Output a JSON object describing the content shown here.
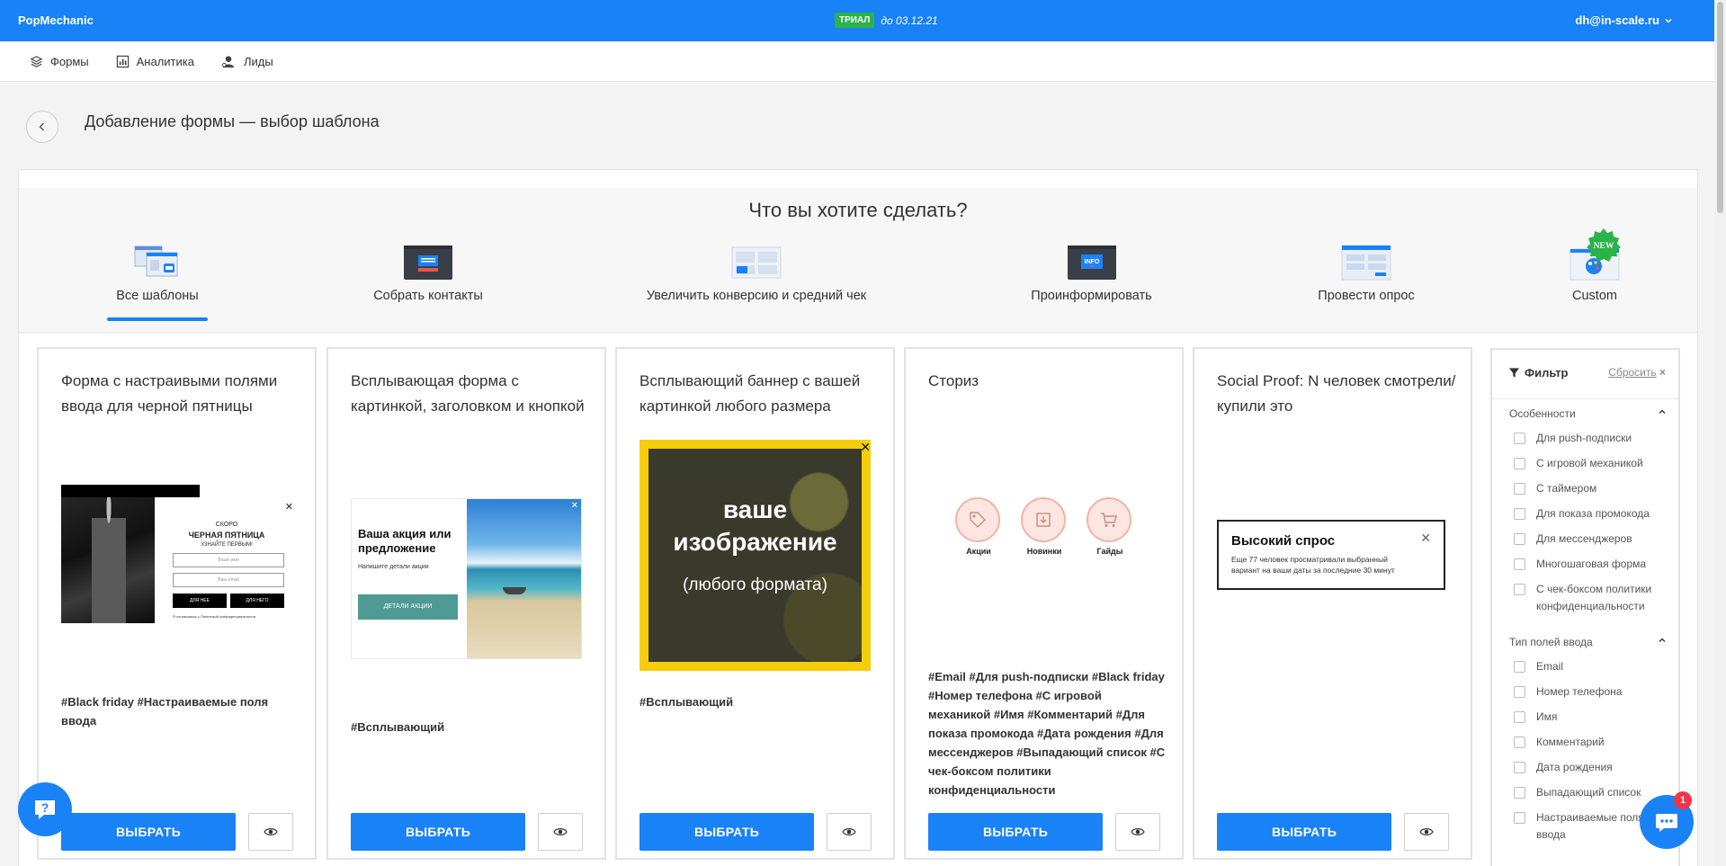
{
  "app": {
    "brand": "PopMechanic",
    "trial_badge": "ТРИАЛ",
    "trial_until": "до 03.12.21",
    "user_email": "dh@in-scale.ru"
  },
  "nav": {
    "items": [
      {
        "label": "Формы",
        "icon": "layers-icon"
      },
      {
        "label": "Аналитика",
        "icon": "analytics-icon"
      },
      {
        "label": "Лиды",
        "icon": "leads-icon"
      }
    ]
  },
  "page": {
    "title": "Добавление формы — выбор шаблона",
    "question": "Что вы хотите сделать?"
  },
  "categories": [
    {
      "label": "Все шаблоны",
      "active": true
    },
    {
      "label": "Собрать контакты"
    },
    {
      "label": "Увеличить конверсию и средний чек"
    },
    {
      "label": "Проинформировать",
      "icon_text": "INFO"
    },
    {
      "label": "Провести опрос"
    },
    {
      "label": "Custom",
      "badge": "NEW"
    }
  ],
  "cards": [
    {
      "title": "Форма с настраивыми полями ввода для черной пятницы",
      "tags": "#Black friday #Настраиваемые поля ввода",
      "preview": {
        "line1": "СКОРО",
        "line2": "ЧЕРНАЯ ПЯТНИЦА",
        "line3": "УЗНАЙТЕ ПЕРВЫМ!",
        "field1": "Ваше имя",
        "field2": "Ваш email",
        "btn1": "ДЛЯ НЕЕ",
        "btn2": "ДЛЯ НЕГО",
        "consent": "Я соглашаюсь с Политикой конфиденциальности"
      }
    },
    {
      "title": "Всплывающая форма с картинкой, заголовком и кнопкой",
      "tags": "#Всплывающий",
      "preview": {
        "heading": "Ваша акция или предложение",
        "sub": "Напишите детали акции",
        "button": "ДЕТАЛИ АКЦИИ"
      }
    },
    {
      "title": "Всплывающий баннер с вашей картинкой любого размера",
      "tags": "#Всплывающий",
      "preview": {
        "line1": "ваше",
        "line2": "изображение",
        "line3": "(любого формата)"
      }
    },
    {
      "title": "Сториз",
      "tags": "#Email #Для push-подписки #Black friday #Номер телефона #С игровой механикой #Имя #Комментарий #Для показа промокода #Дата рождения #Для мессенджеров #Выпадающий список #С чек-боксом политики конфиденциальности",
      "preview": {
        "items": [
          {
            "label": "Акции",
            "icon": "tag-icon"
          },
          {
            "label": "Новинки",
            "icon": "download-icon"
          },
          {
            "label": "Гайды",
            "icon": "cart-icon"
          }
        ]
      }
    },
    {
      "title": "Social Proof: N человек смотрели/купили это",
      "tags": "",
      "preview": {
        "heading": "Высокий спрос",
        "text": "Еще 77 человек просматривали выбранный вариант на ваши даты за последние 30 минут"
      }
    }
  ],
  "buttons": {
    "select": "ВЫБРАТЬ"
  },
  "filter": {
    "title": "Фильтр",
    "reset": "Сбросить",
    "reset_x": "×",
    "sections": [
      {
        "title": "Особенности",
        "options": [
          "Для push-подписки",
          "С игровой механикой",
          "С таймером",
          "Для показа промокода",
          "Для мессенджеров",
          "Многошаговая форма",
          "С чек-боксом политики конфиденциальности"
        ]
      },
      {
        "title": "Тип полей ввода",
        "options": [
          "Email",
          "Номер телефона",
          "Имя",
          "Комментарий",
          "Дата рождения",
          "Выпадающий список",
          "Настраиваемые поля ввода"
        ]
      }
    ]
  },
  "chat": {
    "badge": "1"
  },
  "colors": {
    "primary": "#1a82f7",
    "trial_green": "#2bb34a",
    "banner_yellow": "#f6cd0d",
    "badge_red": "#f2334a",
    "teal_button": "#4f9a93"
  }
}
